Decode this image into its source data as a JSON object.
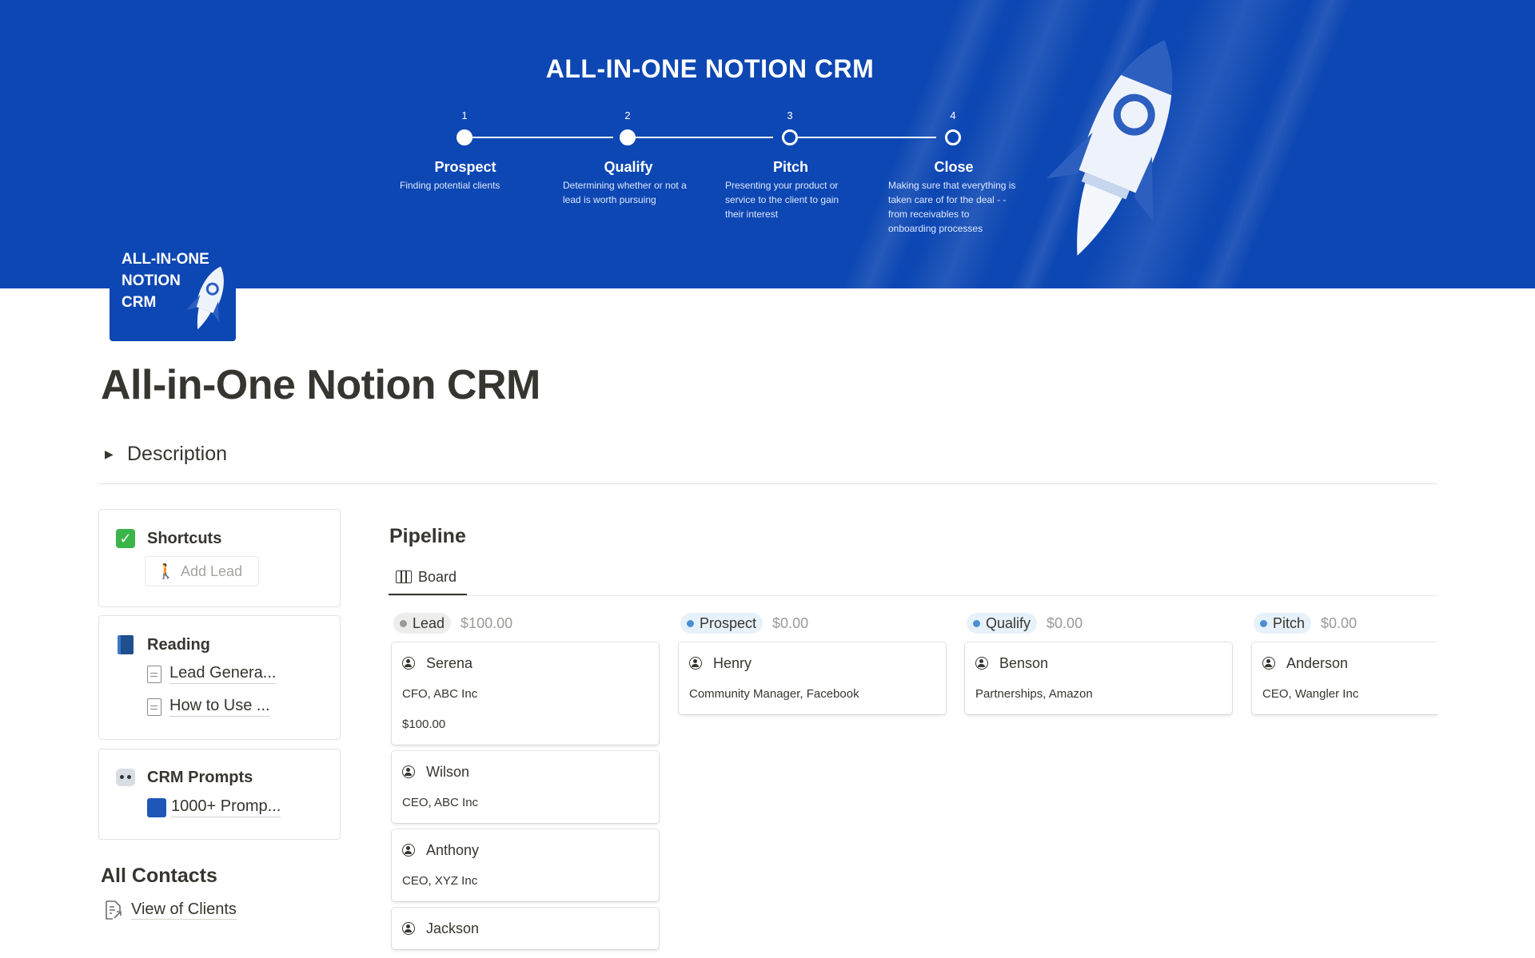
{
  "cover": {
    "title": "ALL-IN-ONE NOTION CRM",
    "steps": [
      {
        "num": "1",
        "name": "Prospect",
        "desc": "Finding potential clients"
      },
      {
        "num": "2",
        "name": "Qualify",
        "desc": "Determining whether or not a lead is worth pursuing"
      },
      {
        "num": "3",
        "name": "Pitch",
        "desc": "Presenting your product or service to the client to gain their interest"
      },
      {
        "num": "4",
        "name": "Close",
        "desc": "Making sure that everything is taken care of for the deal - - from receivables to onboarding processes"
      }
    ]
  },
  "page_icon": {
    "text": "ALL-IN-ONE\nNOTION\nCRM"
  },
  "page": {
    "title": "All-in-One Notion CRM",
    "description_label": "Description"
  },
  "sidebar": {
    "shortcuts": {
      "title": "Shortcuts",
      "icon": "check-mark-icon",
      "add_lead": "Add Lead"
    },
    "reading": {
      "title": "Reading",
      "icon": "book-icon",
      "links": [
        "Lead Genera...",
        "How to Use ..."
      ]
    },
    "prompts": {
      "title": "CRM Prompts",
      "icon": "robot-icon",
      "links": [
        "1000+ Promp..."
      ]
    },
    "contacts": {
      "title": "All Contacts",
      "link": "View of Clients"
    }
  },
  "pipeline": {
    "title": "Pipeline",
    "view_tab": "Board",
    "columns": [
      {
        "label": "Lead",
        "sum": "$100.00",
        "dot_color": "#9b9a97",
        "pill_bg": "#ededec",
        "cards": [
          {
            "name": "Serena",
            "role": "CFO, ABC Inc",
            "value": "$100.00"
          },
          {
            "name": "Wilson",
            "role": "CEO, ABC Inc"
          },
          {
            "name": "Anthony",
            "role": "CEO, XYZ Inc"
          },
          {
            "name": "Jackson"
          }
        ]
      },
      {
        "label": "Prospect",
        "sum": "$0.00",
        "dot_color": "#4a8fd4",
        "pill_bg": "#e7f1fa",
        "cards": [
          {
            "name": "Henry",
            "role": "Community Manager, Facebook"
          }
        ]
      },
      {
        "label": "Qualify",
        "sum": "$0.00",
        "dot_color": "#4a8fd4",
        "pill_bg": "#e7f1fa",
        "cards": [
          {
            "name": "Benson",
            "role": "Partnerships, Amazon"
          }
        ]
      },
      {
        "label": "Pitch",
        "sum": "$0.00",
        "dot_color": "#4a8fd4",
        "pill_bg": "#e7f1fa",
        "cards": [
          {
            "name": "Anderson",
            "role": "CEO, Wangler Inc"
          }
        ]
      }
    ]
  }
}
